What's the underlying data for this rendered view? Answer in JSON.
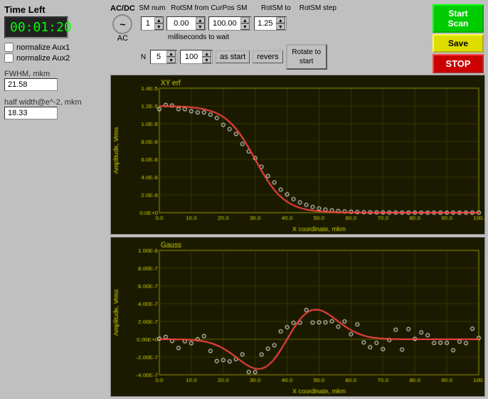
{
  "header": {
    "time_left_label": "Time Left",
    "time_value": "00:01:20"
  },
  "checkboxes": {
    "normalize_aux1": {
      "label": "normalize Aux1",
      "checked": false
    },
    "normalize_aux2": {
      "label": "normalize Aux2",
      "checked": false
    }
  },
  "fwhm": {
    "label": "FWHM, mkm",
    "value": "21.58"
  },
  "half_width": {
    "label": "half width@e^-2, mkm",
    "value": "18.33"
  },
  "acdc": {
    "label": "AC/DC",
    "symbol": "~",
    "mode": "AC"
  },
  "sm_controls": {
    "sm_num_label": "SM num",
    "sm_num_value": "1",
    "rot_sm_from_label": "RotSM from CurPos SM",
    "rot_sm_from_value": "0.00",
    "rot_sm_to_label": "RotSM to",
    "rot_sm_to_value": "100.00",
    "rot_sm_step_label": "RotSM step",
    "rot_sm_step_value": "1.25",
    "n_label": "N",
    "n_value": "5",
    "ms_value": "100",
    "ms_wait_label": "milliseconds to wait"
  },
  "buttons": {
    "start_scan": "Start Scan",
    "save": "Save",
    "stop": "STOP",
    "as_start": "as start",
    "revers": "revers",
    "rotate_to_start": "Rotate to\nstart"
  },
  "chart1": {
    "y_label": "Amplitude, Vrms",
    "x_label": "X coordinate, mkm",
    "title": "XY erf",
    "y_axis_label_top": "1.4E-5",
    "y_ticks": [
      "1.4E-5",
      "1.2E-5",
      "1.0E-5",
      "8.0E-6",
      "6.0E-6",
      "4.0E-6",
      "2.0E-6",
      "0.0E+0"
    ],
    "x_ticks": [
      "0.0",
      "10.0",
      "20.0",
      "30.0",
      "40.0",
      "50.0",
      "60.0",
      "70.0",
      "80.0",
      "90.0",
      "100."
    ]
  },
  "chart2": {
    "y_label": "Amplitude, Vrms",
    "x_label": "X coordinate, mkm",
    "title": "Gauss",
    "y_ticks": [
      "1.00E-6",
      "8.00E-7",
      "6.00E-7",
      "4.00E-7",
      "2.00E-7",
      "0.00E+0",
      "-2.00E-7",
      "-4.00E-7"
    ],
    "x_ticks": [
      "0.0",
      "10.0",
      "20.0",
      "30.0",
      "40.0",
      "50.0",
      "60.0",
      "70.0",
      "80.0",
      "90.0",
      "100."
    ]
  }
}
